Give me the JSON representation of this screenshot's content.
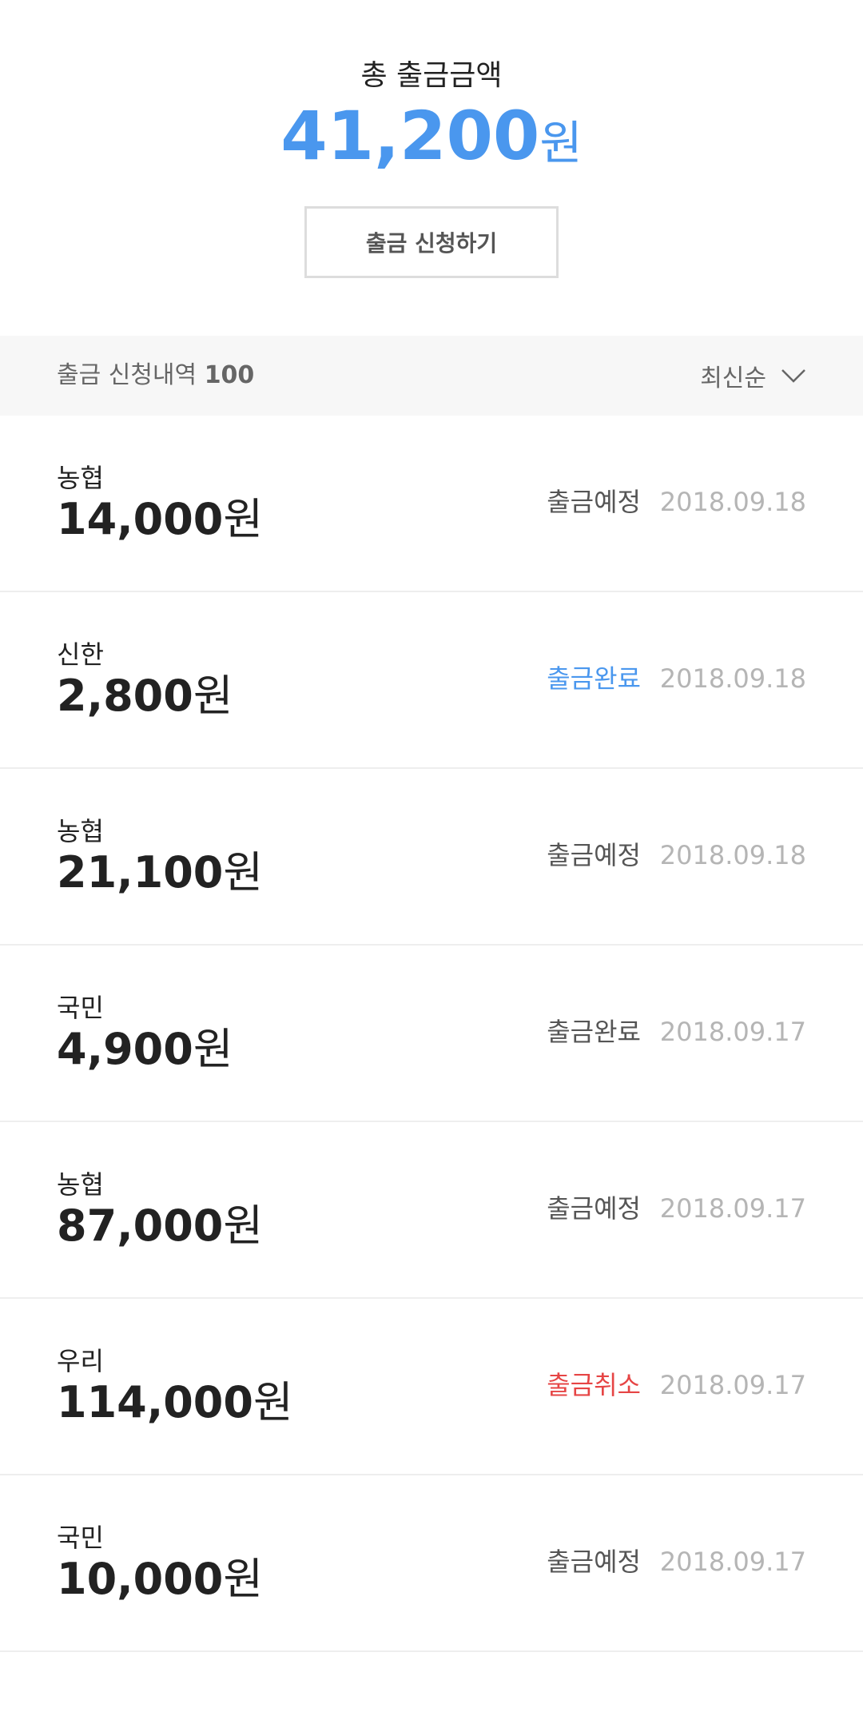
{
  "summary": {
    "label": "총 출금금액",
    "amount": "41,200",
    "unit": "원",
    "apply_button_label": "출금 신청하기"
  },
  "list_header": {
    "title": "출금 신청내역",
    "count": "100",
    "sort_label": "최신순",
    "sort_icon": "chevron-down-icon"
  },
  "colors": {
    "accent_blue": "#4a97ee",
    "cancel_red": "#e64545",
    "status_gray": "#555555",
    "date_gray": "#b5b5b5"
  },
  "withdrawals": [
    {
      "bank": "농협",
      "amount": "14,000",
      "unit": "원",
      "status": "출금예정",
      "status_color": "#555555",
      "date": "2018.09.18"
    },
    {
      "bank": "신한",
      "amount": "2,800",
      "unit": "원",
      "status": "출금완료",
      "status_color": "#4a97ee",
      "date": "2018.09.18"
    },
    {
      "bank": "농협",
      "amount": "21,100",
      "unit": "원",
      "status": "출금예정",
      "status_color": "#555555",
      "date": "2018.09.18"
    },
    {
      "bank": "국민",
      "amount": "4,900",
      "unit": "원",
      "status": "출금완료",
      "status_color": "#555555",
      "date": "2018.09.17"
    },
    {
      "bank": "농협",
      "amount": "87,000",
      "unit": "원",
      "status": "출금예정",
      "status_color": "#555555",
      "date": "2018.09.17"
    },
    {
      "bank": "우리",
      "amount": "114,000",
      "unit": "원",
      "status": "출금취소",
      "status_color": "#e64545",
      "date": "2018.09.17"
    },
    {
      "bank": "국민",
      "amount": "10,000",
      "unit": "원",
      "status": "출금예정",
      "status_color": "#555555",
      "date": "2018.09.17"
    }
  ]
}
